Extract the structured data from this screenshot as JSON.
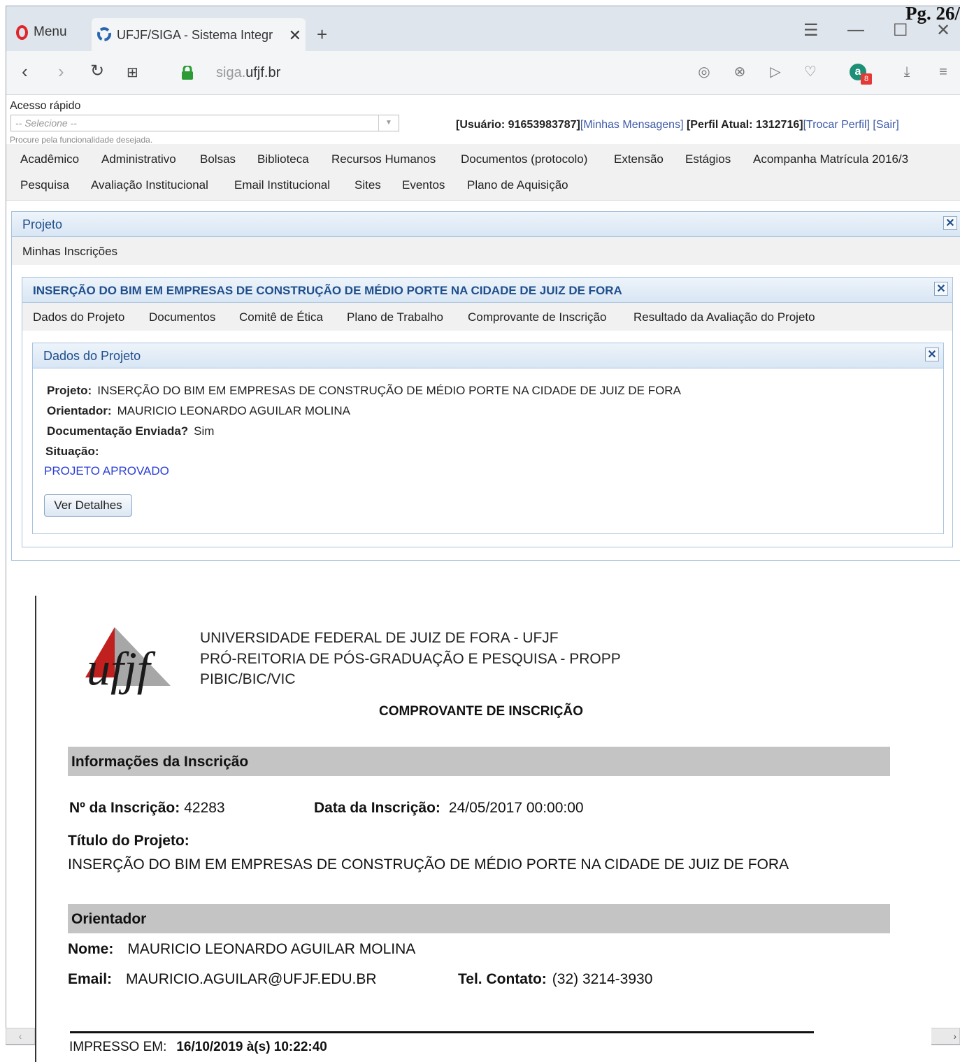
{
  "page_label": "Pg. 26/",
  "browser": {
    "menu_label": "Menu",
    "tab_title": "UFJF/SIGA - Sistema Integr",
    "url_dim": "siga.",
    "url_main": "ufjf.br",
    "vpn_count": "8"
  },
  "siga": {
    "quick_access_label": "Acesso rápido",
    "quick_access_placeholder": "-- Selecione --",
    "quick_access_hint": "Procure pela funcionalidade desejada.",
    "user": {
      "usuario_label": "[Usuário: 91653983787]",
      "mensagens": "[Minhas Mensagens]",
      "perfil_label": " [Perfil Atual: 1312716]",
      "trocar_perfil": "[Trocar Perfil]",
      "sair": " [Sair]"
    },
    "menu_row1": [
      "Acadêmico",
      "Administrativo",
      "Bolsas",
      "Biblioteca",
      "Recursos Humanos",
      "Documentos (protocolo)",
      "Extensão",
      "Estágios",
      "Acompanha Matrícula 2016/3"
    ],
    "menu_row2": [
      "Pesquisa",
      "Avaliação Institucional",
      "Email Institucional",
      "Sites",
      "Eventos",
      "Plano de Aquisição"
    ],
    "projeto_panel_title": "Projeto",
    "minhas_inscricoes": "Minhas Inscrições",
    "inner_panel_title": "INSERÇÃO DO BIM EM EMPRESAS DE CONSTRUÇÃO DE MÉDIO PORTE NA CIDADE DE JUIZ DE FORA",
    "project_tabs": [
      "Dados do Projeto",
      "Documentos",
      "Comitê de Ética",
      "Plano de Trabalho",
      "Comprovante de Inscrição",
      "Resultado da Avaliação do Projeto"
    ],
    "dados_panel_title": "Dados do Projeto",
    "fields": {
      "projeto_label": "Projeto:",
      "projeto_value": "INSERÇÃO DO BIM EM EMPRESAS DE CONSTRUÇÃO DE MÉDIO PORTE NA CIDADE DE JUIZ DE FORA",
      "orientador_label": "Orientador:",
      "orientador_value": "MAURICIO LEONARDO AGUILAR MOLINA",
      "doc_label": "Documentação Enviada?",
      "doc_value": "Sim",
      "situacao_label": "Situação:",
      "situacao_value": "PROJETO APROVADO"
    },
    "ver_detalhes": "Ver Detalhes"
  },
  "document": {
    "header_lines": [
      "UNIVERSIDADE FEDERAL DE JUIZ DE FORA - UFJF",
      "PRÓ-REITORIA DE PÓS-GRADUAÇÃO E PESQUISA - PROPP",
      "PIBIC/BIC/VIC"
    ],
    "logo_text": "ufjf",
    "title": "COMPROVANTE DE INSCRIÇÃO",
    "section_inscricao": "Informações da Inscrição",
    "n_inscricao_label": "Nº da Inscrição:",
    "n_inscricao_value": "42283",
    "data_inscricao_label": "Data da Inscrição:",
    "data_inscricao_value": "24/05/2017 00:00:00",
    "titulo_label": "Título do Projeto:",
    "titulo_value": "INSERÇÃO DO BIM EM EMPRESAS DE CONSTRUÇÃO DE MÉDIO PORTE NA CIDADE DE JUIZ DE FORA",
    "section_orientador": "Orientador",
    "nome_label": "Nome:",
    "nome_value": "MAURICIO LEONARDO AGUILAR MOLINA",
    "email_label": "Email:",
    "email_value": "MAURICIO.AGUILAR@UFJF.EDU.BR",
    "tel_label": "Tel. Contato:",
    "tel_value": "(32) 3214-3930",
    "impresso_label": "IMPRESSO EM:",
    "impresso_value": "16/10/2019 à(s) 10:22:40"
  },
  "colors": {
    "link": "#3c5aa8",
    "panel_title": "#1f4e8c",
    "section_bg": "#c4c4c4",
    "opera_red": "#e0242b"
  }
}
